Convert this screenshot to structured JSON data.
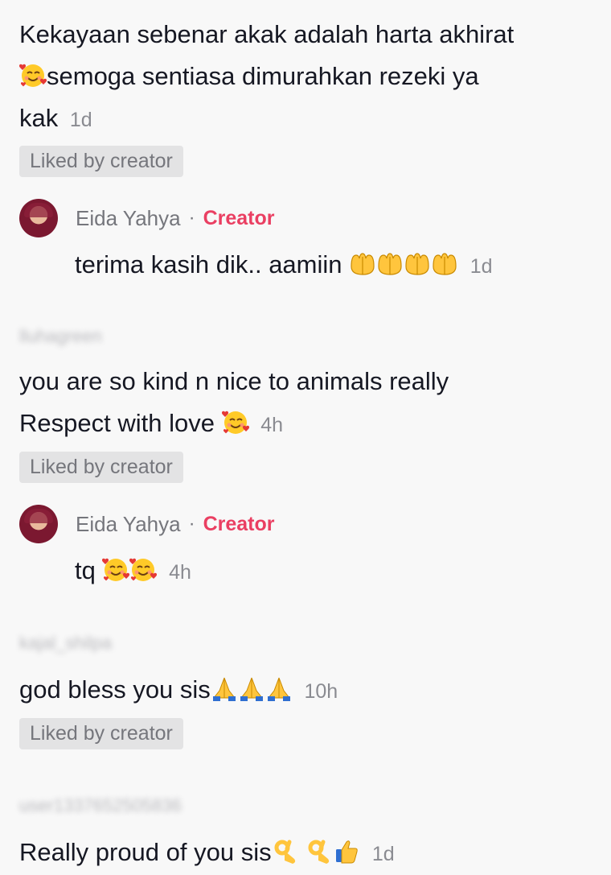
{
  "comments": [
    {
      "text": "Kekayaan sebenar akak adalah harta akhirat",
      "text2": "semoga sentiasa dimurahkan rezeki ya",
      "text3": "kak",
      "time": "1d",
      "liked": "Liked by creator",
      "reply": {
        "name": "Eida Yahya",
        "separator": "·",
        "tag": "Creator",
        "text": "terima kasih dik.. aamiin",
        "time": "1d"
      }
    },
    {
      "username": "lluhagreen",
      "text": "you are so kind n nice to animals really",
      "text2": "Respect with love",
      "time": "4h",
      "liked": "Liked by creator",
      "reply": {
        "name": "Eida Yahya",
        "separator": "·",
        "tag": "Creator",
        "text": "tq",
        "time": "4h"
      }
    },
    {
      "username": "kajal_shilpa",
      "text": "god bless you sis",
      "time": "10h",
      "liked": "Liked by creator"
    },
    {
      "username": "user1337652505836",
      "text": "Really proud of you sis",
      "time": "1d"
    }
  ],
  "icons": {
    "smiling-hearts": "smiling-face-with-hearts-icon",
    "palms-up": "palms-up-together-icon",
    "folded-hands": "folded-hands-icon",
    "ok-hand": "ok-hand-icon",
    "thumbs-up": "thumbs-up-icon"
  },
  "colors": {
    "creator": "#ea3f62",
    "chip_bg": "#e3e3e4",
    "muted": "#75767c"
  }
}
